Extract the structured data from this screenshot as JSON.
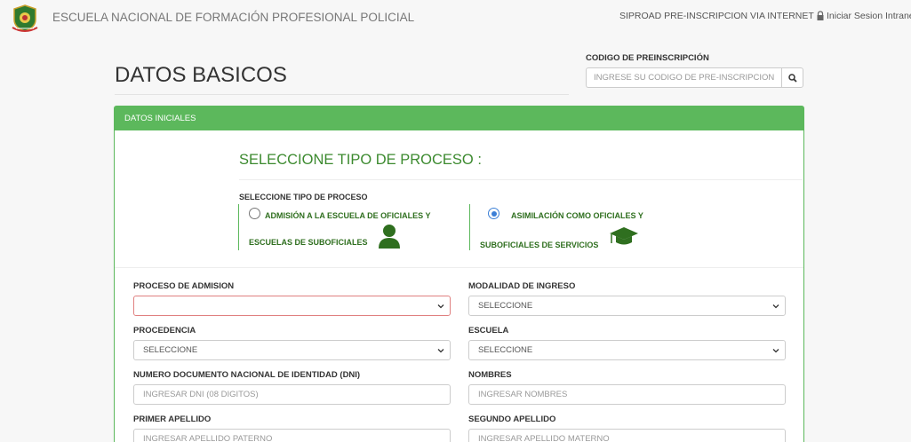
{
  "header": {
    "brand": "ESCUELA NACIONAL DE FORMACIÓN PROFESIONAL POLICIAL",
    "nav_link_1": "SIPROAD PRE-INSCRIPCION VIA INTERNET",
    "nav_link_2": "Iniciar Sesion Intranet"
  },
  "page": {
    "title": "DATOS BASICOS"
  },
  "code_search": {
    "label": "CODIGO DE PREINSCRIPCIÓN",
    "placeholder": "INGRESE SU CODIGO DE PRE-INSCRIPCION"
  },
  "panel": {
    "heading": "DATOS INICIALES",
    "process_title": "SELECCIONE TIPO DE PROCESO :",
    "process_subtitle": "SELECCIONE TIPO DE PROCESO",
    "options": [
      {
        "line1": "ADMISIÓN A LA ESCUELA DE OFICIALES Y",
        "line2": "ESCUELAS DE SUBOFICIALES",
        "icon": "user-icon",
        "selected": false
      },
      {
        "line1": "ASIMILACIÓN COMO OFICIALES Y",
        "line2": "SUBOFICIALES DE SERVICIOS",
        "icon": "graduation-cap-icon",
        "selected": true
      }
    ]
  },
  "form": {
    "proceso_label": "PROCESO DE ADMISION",
    "proceso_value": "",
    "modalidad_label": "MODALIDAD DE INGRESO",
    "modalidad_value": "SELECCIONE",
    "procedencia_label": "PROCEDENCIA",
    "procedencia_value": "SELECCIONE",
    "escuela_label": "ESCUELA",
    "escuela_value": "SELECCIONE",
    "dni_label": "NUMERO DOCUMENTO NACIONAL DE IDENTIDAD (DNI)",
    "dni_placeholder": "INGRESAR DNI (08 DIGITOS)",
    "nombres_label": "NOMBRES",
    "nombres_placeholder": "INGRESAR NOMBRES",
    "apellido1_label": "PRIMER APELLIDO",
    "apellido1_placeholder": "INGRESAR APELLIDO PATERNO",
    "apellido2_label": "SEGUNDO APELLIDO",
    "apellido2_placeholder": "INGRESAR APELLIDO MATERNO"
  },
  "colors": {
    "accent_green": "#5cb85c",
    "text_green": "#2f6f1f",
    "radio_blue": "#3b7fd6",
    "error_red": "#e08080"
  }
}
